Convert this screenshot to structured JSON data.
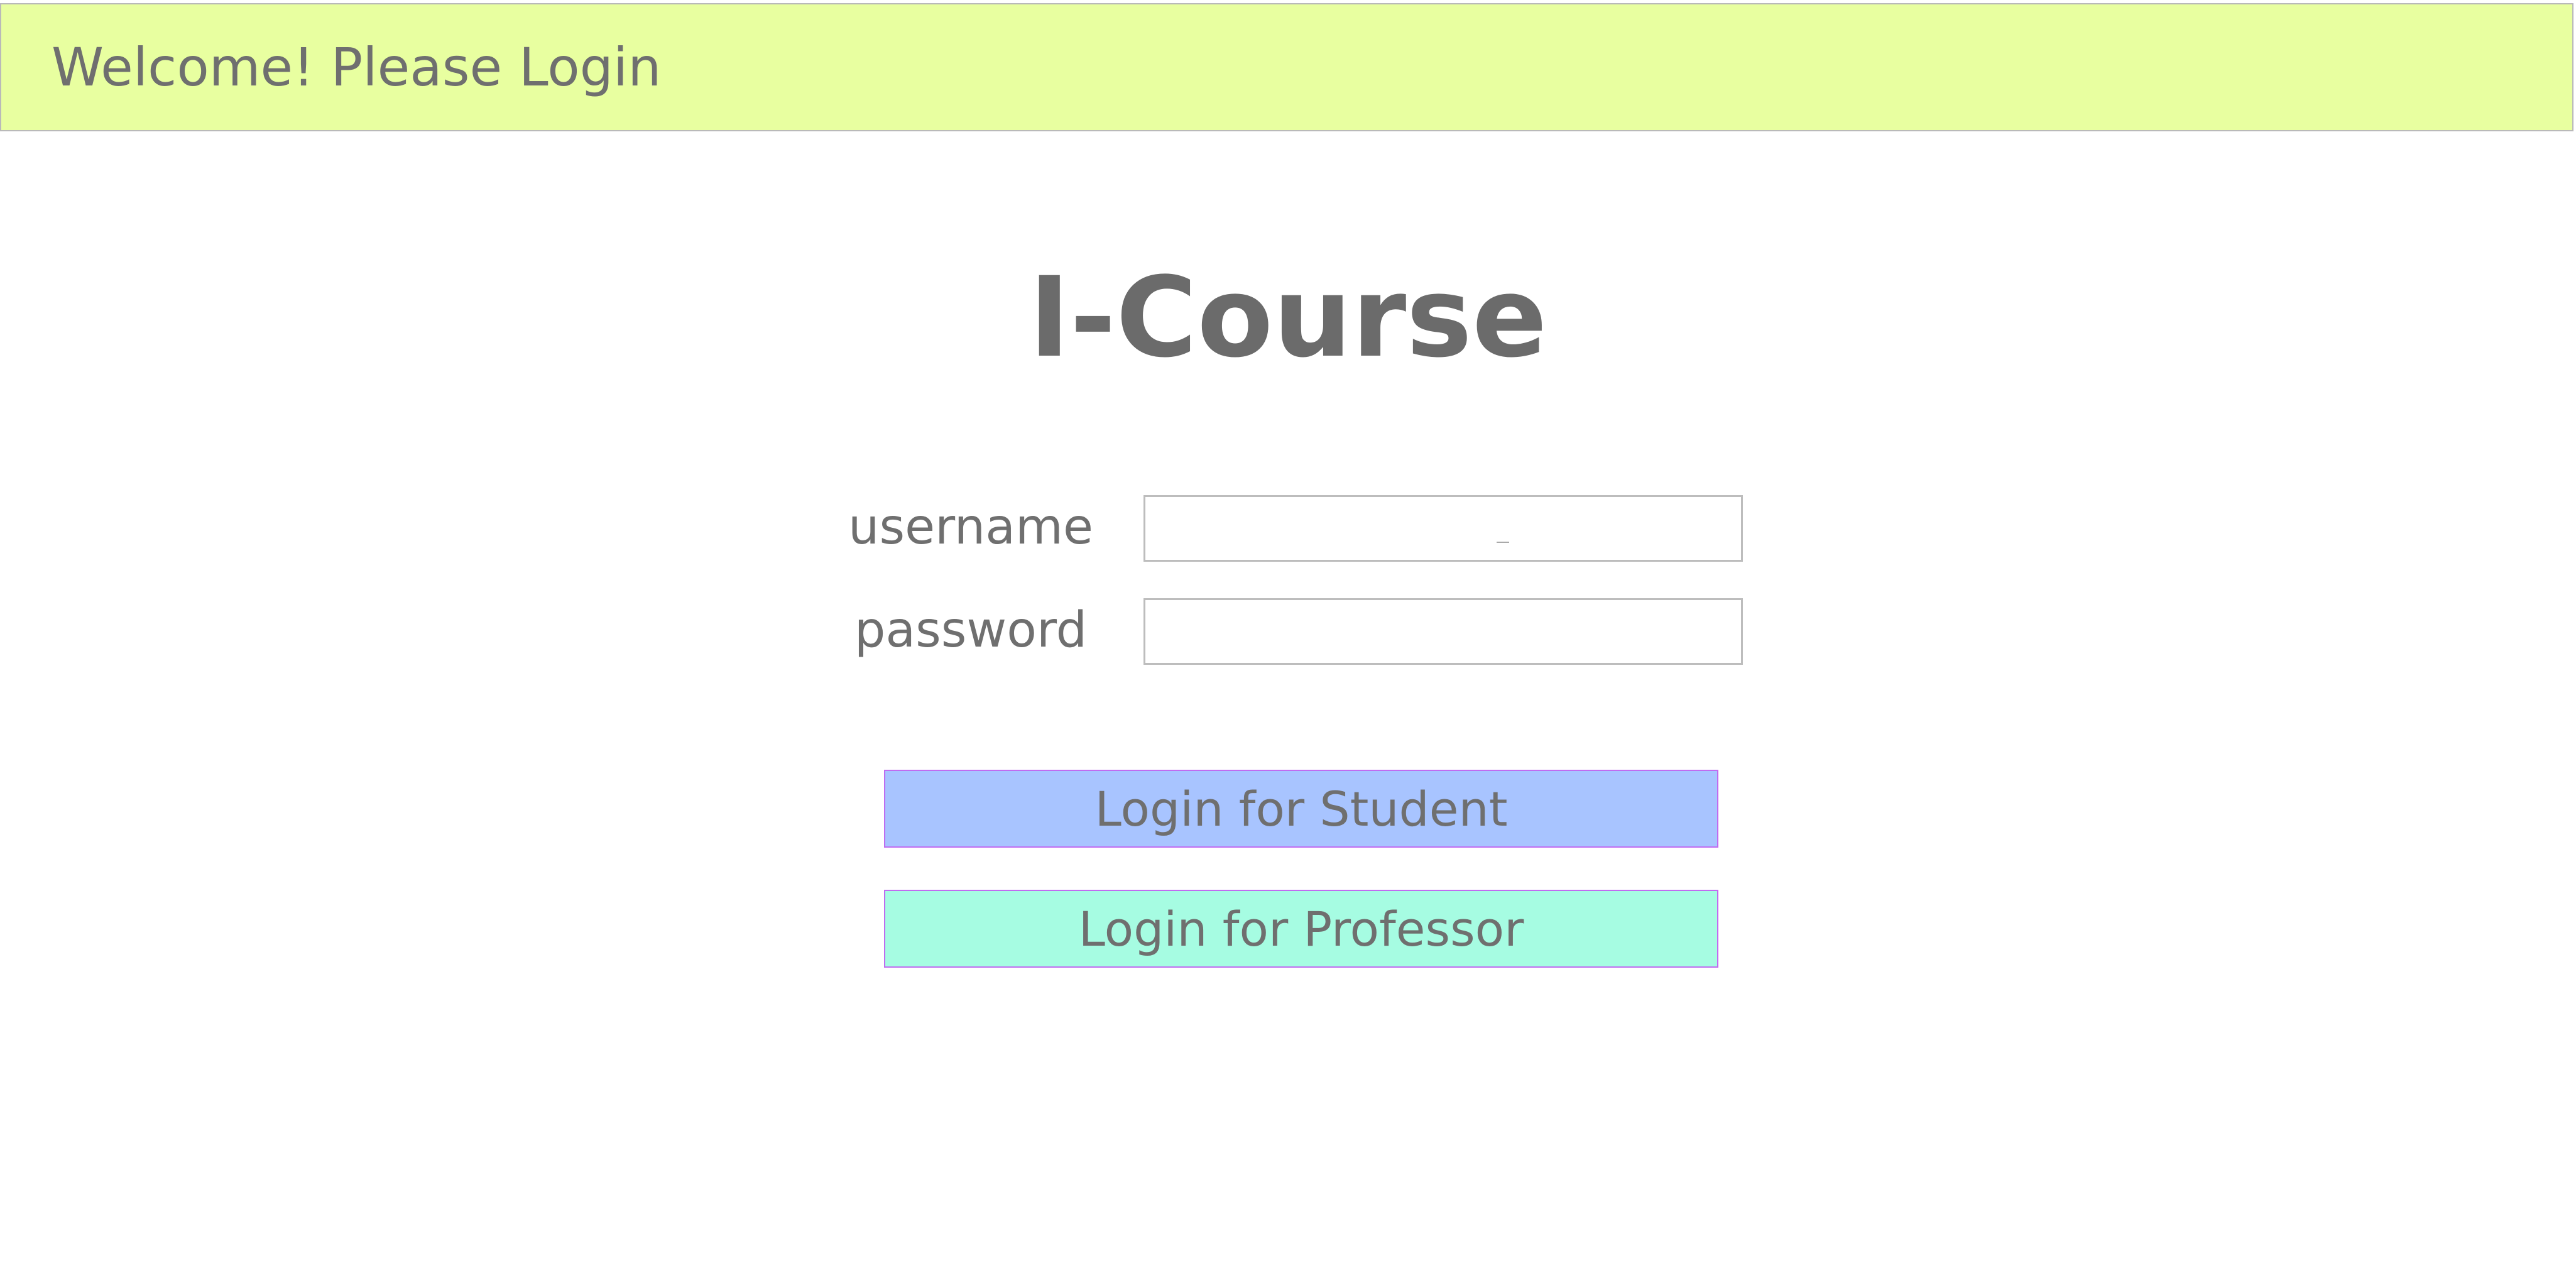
{
  "header": {
    "title": "Welcome! Please Login",
    "background_color": "#e8ffa0"
  },
  "main": {
    "app_title": "I-Course",
    "form": {
      "username_label": "username",
      "username_value": "",
      "password_label": "password",
      "password_value": ""
    },
    "buttons": {
      "student_label": "Login for Student",
      "student_color": "#a8c4ff",
      "professor_label": "Login for Professor",
      "professor_color": "#a6fce2"
    }
  }
}
